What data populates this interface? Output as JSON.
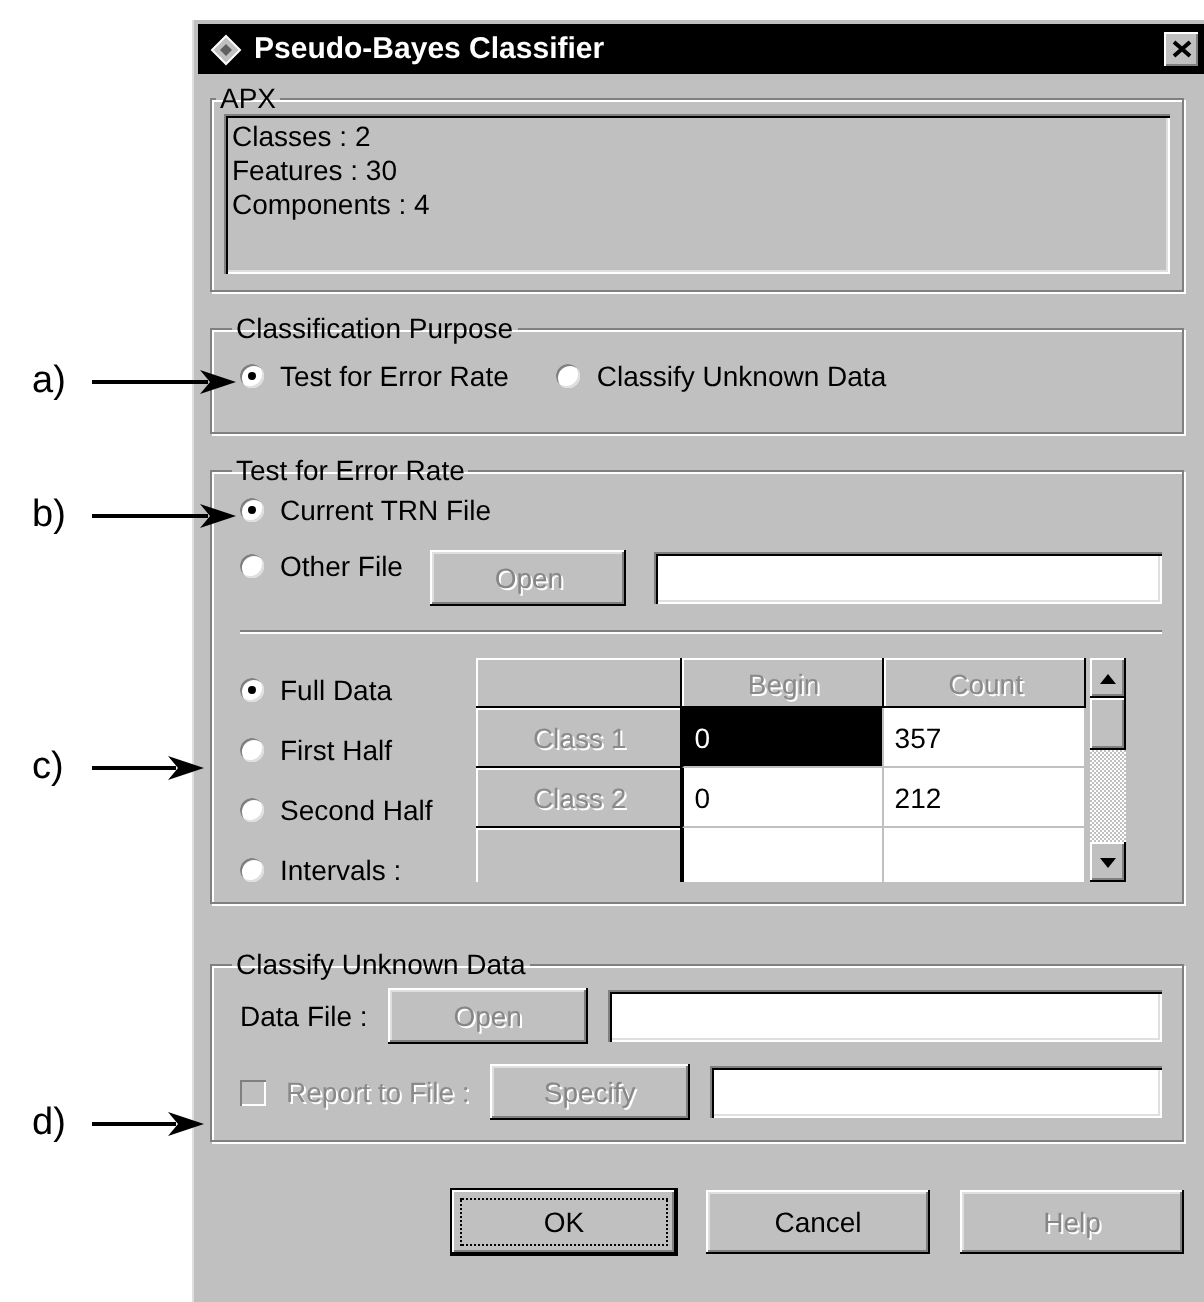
{
  "annotations": [
    {
      "label": "a)",
      "kind": "long"
    },
    {
      "label": "b)",
      "kind": "long"
    },
    {
      "label": "c)",
      "kind": "short"
    },
    {
      "label": "d)",
      "kind": "short"
    }
  ],
  "window": {
    "title": "Pseudo-Bayes Classifier"
  },
  "apx": {
    "title": "APX",
    "lines": [
      "Classes : 2",
      "Features : 30",
      "Components : 4"
    ]
  },
  "purpose": {
    "title": "Classification Purpose",
    "options": [
      {
        "label": "Test for Error Rate",
        "selected": true
      },
      {
        "label": "Classify Unknown Data",
        "selected": false
      }
    ]
  },
  "test": {
    "title": "Test for Error Rate",
    "sources": [
      {
        "label": "Current TRN File",
        "selected": true
      },
      {
        "label": "Other File",
        "selected": false
      }
    ],
    "open_button": {
      "label": "Open",
      "disabled": true
    },
    "ranges": [
      {
        "label": "Full Data",
        "selected": true
      },
      {
        "label": "First Half",
        "selected": false
      },
      {
        "label": "Second Half",
        "selected": false
      },
      {
        "label": "Intervals :",
        "selected": false
      }
    ],
    "grid": {
      "columns": [
        "Begin",
        "Count"
      ],
      "rows": [
        {
          "header": "Class 1",
          "cells": [
            {
              "value": "0",
              "selected": true
            },
            {
              "value": "357",
              "selected": false
            }
          ]
        },
        {
          "header": "Class 2",
          "cells": [
            {
              "value": "0",
              "selected": false
            },
            {
              "value": "212",
              "selected": false
            }
          ]
        }
      ]
    }
  },
  "classify": {
    "title": "Classify Unknown Data",
    "data_file": {
      "label": "Data File :",
      "button": {
        "label": "Open",
        "disabled": true
      }
    },
    "report": {
      "label": "Report to File :",
      "checked": false,
      "disabled": true,
      "button": {
        "label": "Specify",
        "disabled": true
      }
    }
  },
  "buttons": [
    {
      "label": "OK",
      "focused": true,
      "disabled": false
    },
    {
      "label": "Cancel",
      "focused": false,
      "disabled": false
    },
    {
      "label": "Help",
      "focused": false,
      "disabled": true
    }
  ]
}
